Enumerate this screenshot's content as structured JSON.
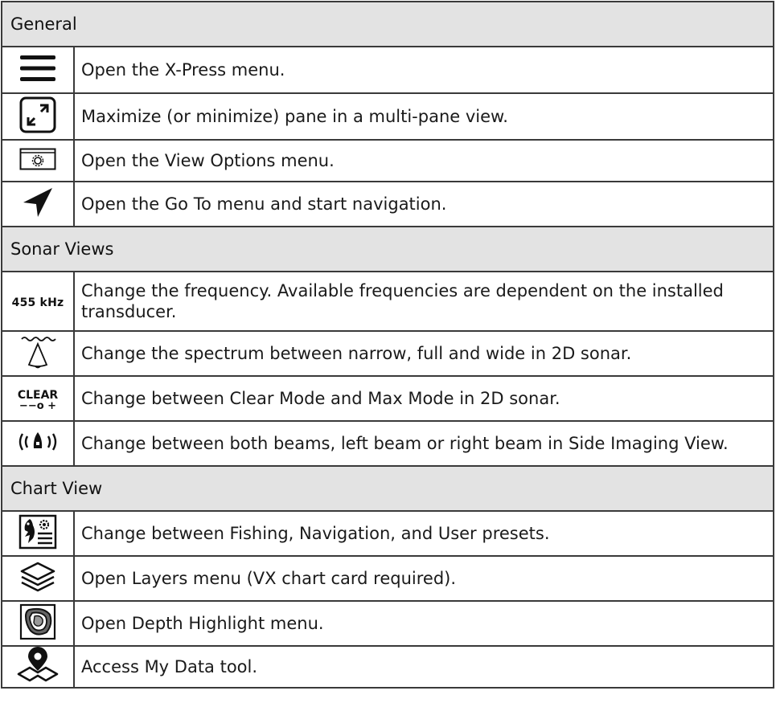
{
  "sections": [
    {
      "title": "General",
      "rows": [
        {
          "icon": "hamburger-menu-icon",
          "text": "Open the X-Press menu."
        },
        {
          "icon": "maximize-icon",
          "text": "Maximize (or minimize) pane in a multi-pane view."
        },
        {
          "icon": "view-options-icon",
          "text": "Open the View Options menu."
        },
        {
          "icon": "navigation-arrow-icon",
          "text": "Open the Go To menu and start navigation."
        }
      ]
    },
    {
      "title": "Sonar Views",
      "rows": [
        {
          "icon": "frequency-icon",
          "icon_text": "455 kHz",
          "text": "Change the frequency. Available frequencies are dependent on the installed transducer."
        },
        {
          "icon": "spectrum-icon",
          "text": "Change the spectrum between narrow, full and wide in 2D sonar."
        },
        {
          "icon": "clear-mode-icon",
          "icon_text": "CLEAR",
          "icon_subtext": "−−o  +",
          "text": "Change between Clear Mode and Max Mode in 2D sonar."
        },
        {
          "icon": "side-imaging-beams-icon",
          "text": "Change between both beams, left beam or right beam in Side Imaging View."
        }
      ]
    },
    {
      "title": "Chart View",
      "rows": [
        {
          "icon": "fishing-presets-icon",
          "text": "Change between Fishing, Navigation, and User presets."
        },
        {
          "icon": "layers-icon",
          "text": "Open Layers menu (VX chart card required)."
        },
        {
          "icon": "depth-highlight-icon",
          "text": "Open Depth Highlight menu."
        },
        {
          "icon": "my-data-icon",
          "text": "Access My Data tool."
        }
      ]
    }
  ]
}
